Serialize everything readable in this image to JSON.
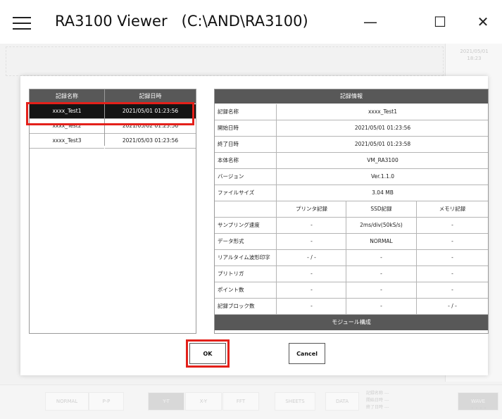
{
  "window": {
    "title": "RA3100 Viewer   (C:\\AND\\RA3100)",
    "minimize": "—",
    "maximize": "☐",
    "close": "✕"
  },
  "background": {
    "date_line1": "2021/05/01",
    "date_line2": "18:23",
    "tabs": [
      "NORMAL",
      "P-P",
      "Y-T",
      "X-Y",
      "FFT",
      "SHEETS",
      "DATA",
      "WAVE"
    ],
    "meta_labels": [
      "記録名称 ---",
      "開始日時 ---",
      "終了日時 ---"
    ],
    "wave_sub": "・・・・"
  },
  "list": {
    "headers": [
      "記録名称",
      "記録日時"
    ],
    "rows": [
      {
        "name": "xxxx_Test1",
        "date": "2021/05/01 01:23:56"
      },
      {
        "name": "xxxx_Test2",
        "date": "2021/05/02 01:23:56"
      },
      {
        "name": "xxxx_Test3",
        "date": "2021/05/03 01:23:56"
      }
    ],
    "selected_index": 0
  },
  "info": {
    "header": "記録情報",
    "rows": [
      {
        "label": "記録名称",
        "value": "xxxx_Test1"
      },
      {
        "label": "開始日時",
        "value": "2021/05/01 01:23:56"
      },
      {
        "label": "終了日時",
        "value": "2021/05/01 01:23:58"
      },
      {
        "label": "本体名称",
        "value": "VM_RA3100"
      },
      {
        "label": "バージョン",
        "value": "Ver.1.1.0"
      },
      {
        "label": "ファイルサイズ",
        "value": "3.04 MB"
      }
    ],
    "columns": [
      "プリンタ記録",
      "SSD記録",
      "メモリ記録"
    ],
    "grid_rows": [
      {
        "label": "サンプリング速度",
        "cells": [
          "-",
          "2ms/div(50kS/s)",
          "-"
        ]
      },
      {
        "label": "データ形式",
        "cells": [
          "-",
          "NORMAL",
          "-"
        ]
      },
      {
        "label": "リアルタイム波形印字",
        "cells": [
          "- / -",
          "-",
          "-"
        ]
      },
      {
        "label": "プリトリガ",
        "cells": [
          "-",
          "-",
          "-"
        ]
      },
      {
        "label": "ポイント数",
        "cells": [
          "-",
          "-",
          "-"
        ]
      },
      {
        "label": "記録ブロック数",
        "cells": [
          "-",
          "-",
          "- / -"
        ]
      }
    ],
    "module_header": "モジュール構成"
  },
  "buttons": {
    "ok": "OK",
    "cancel": "Cancel"
  },
  "colors": {
    "header_bg": "#585858",
    "selected_row_bg": "#141414",
    "highlight_red": "#e3201a"
  }
}
